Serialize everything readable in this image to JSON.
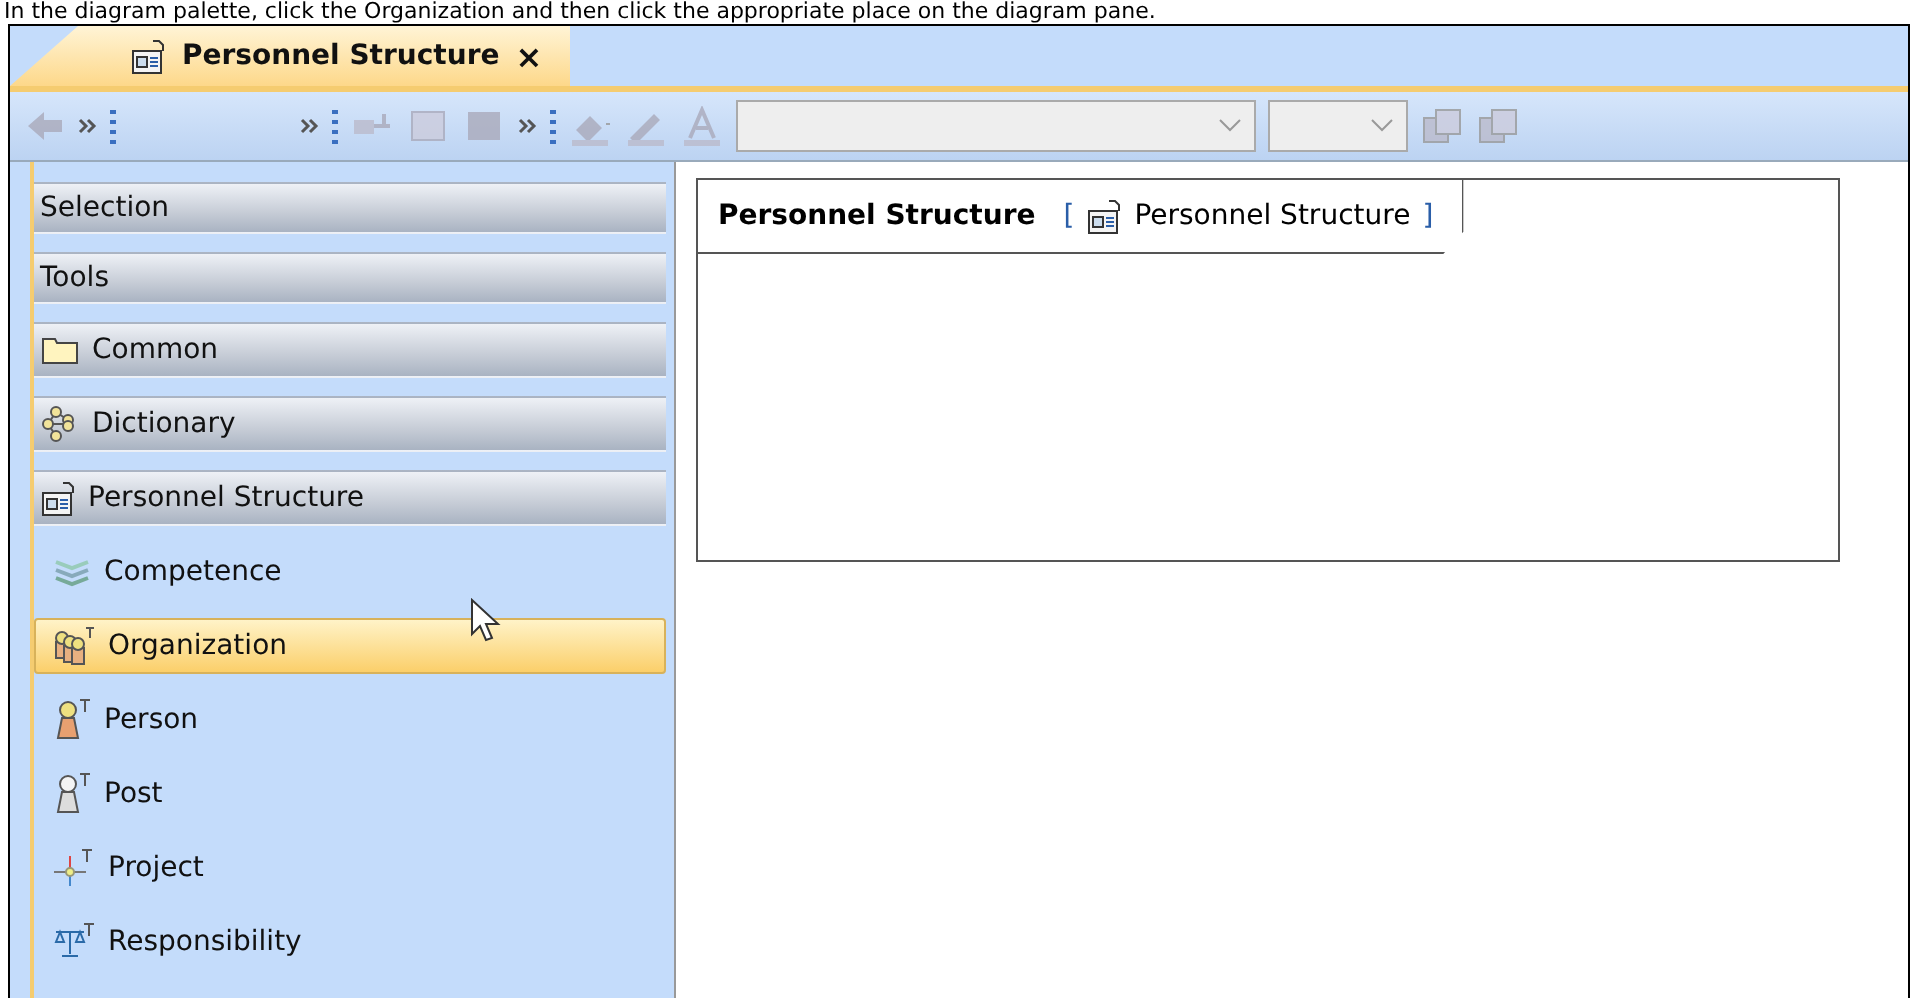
{
  "instruction": "In the diagram palette, click the Organization and then click the appropriate place on the diagram pane.",
  "tabs": [
    {
      "label": "Personnel Structure",
      "close": "×",
      "selected": true
    }
  ],
  "toolbar": {
    "dropdowns": [
      {
        "disabled": true
      },
      {
        "disabled": true
      }
    ]
  },
  "palette": {
    "items": [
      {
        "label": "Selection",
        "kind": "header",
        "selected": false
      },
      {
        "label": "Tools",
        "kind": "header",
        "selected": false
      },
      {
        "label": "Common",
        "kind": "group",
        "selected": false
      },
      {
        "label": "Dictionary",
        "kind": "group",
        "selected": false
      },
      {
        "label": "Personnel Structure",
        "kind": "group",
        "selected": false
      },
      {
        "label": "Competence",
        "kind": "tool",
        "selected": false
      },
      {
        "label": "Organization",
        "kind": "tool",
        "selected": true
      },
      {
        "label": "Person",
        "kind": "tool",
        "selected": false
      },
      {
        "label": "Post",
        "kind": "tool",
        "selected": false
      },
      {
        "label": "Project",
        "kind": "tool",
        "selected": false
      },
      {
        "label": "Responsibility",
        "kind": "tool",
        "selected": false
      }
    ]
  },
  "diagram": {
    "frame_name": "Personnel Structure",
    "open_bracket": "[",
    "type_label": "Personnel Structure",
    "close_bracket": "]"
  }
}
